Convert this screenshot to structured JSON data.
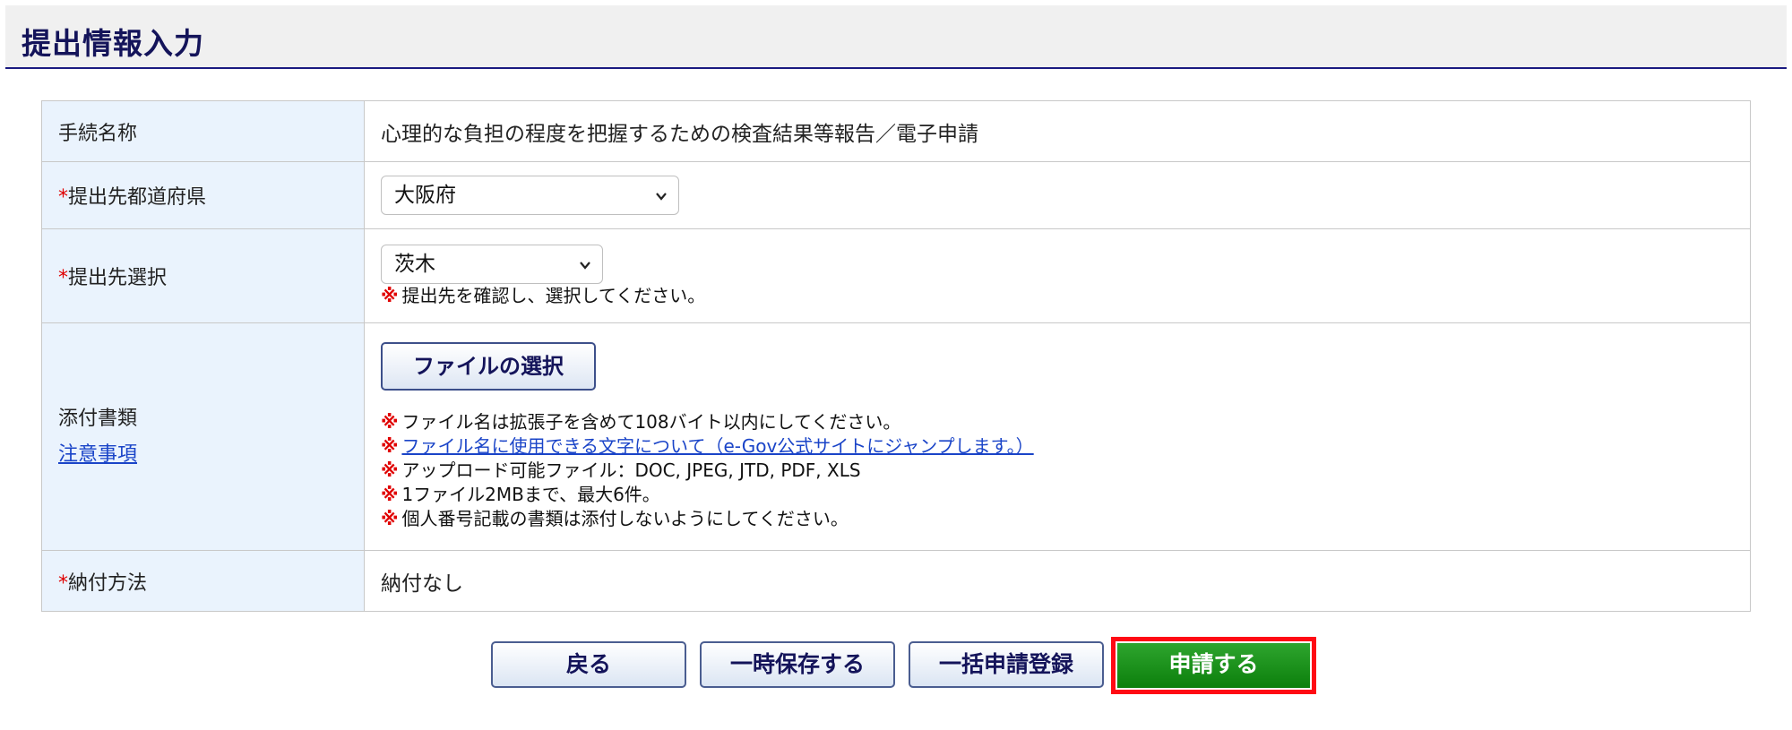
{
  "page": {
    "title": "提出情報入力"
  },
  "form": {
    "procedure": {
      "label": "手続名称",
      "value": "心理的な負担の程度を把握するための検査結果等報告／電子申請"
    },
    "prefecture": {
      "required_mark": "*",
      "label": "提出先都道府県",
      "selected": "大阪府"
    },
    "destination": {
      "required_mark": "*",
      "label": "提出先選択",
      "selected": "茨木",
      "note_mark": "※",
      "note": "提出先を確認し、選択してください。"
    },
    "attachments": {
      "label": "添付書類",
      "notice_link": "注意事項",
      "file_button": "ファイルの選択",
      "notes": [
        {
          "mark": "※",
          "text": "ファイル名は拡張子を含めて108バイト以内にしてください。"
        },
        {
          "mark": "※",
          "text": "ファイル名に使用できる文字について（e-Gov公式サイトにジャンプします。）"
        },
        {
          "mark": "※",
          "text": "アップロード可能ファイル：DOC, JPEG, JTD, PDF, XLS"
        },
        {
          "mark": "※",
          "text": "1ファイル2MBまで、最大6件。"
        },
        {
          "mark": "※",
          "text": "個人番号記載の書類は添付しないようにしてください。"
        }
      ]
    },
    "payment": {
      "required_mark": "*",
      "label": "納付方法",
      "value": "納付なし"
    }
  },
  "actions": {
    "back": "戻る",
    "save_draft": "一時保存する",
    "bulk_register": "一括申請登録",
    "submit": "申請する"
  },
  "icons": {
    "select_arrow": "chevron-down-icon"
  },
  "colors": {
    "label_bg": "#eaf3fd",
    "required": "#e00000",
    "link": "#1a44c8",
    "submit_bg": "#1a8f1a",
    "highlight": "#ff0a14",
    "header_rule": "#1a1a80"
  }
}
